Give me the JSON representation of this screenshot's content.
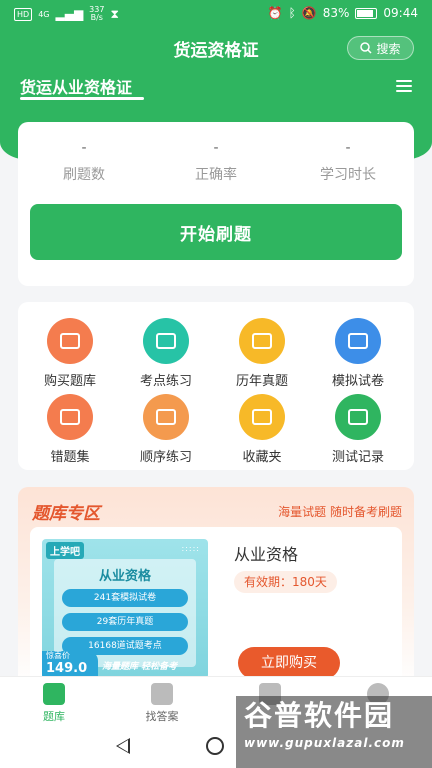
{
  "status_bar": {
    "network": "HD",
    "signal": "4G",
    "speed_value": "337",
    "speed_unit": "B/s",
    "battery": "83%",
    "time": "09:44"
  },
  "header": {
    "title": "货运资格证",
    "search_label": "搜索",
    "cert_tab": "货运从业资格证"
  },
  "stats": [
    {
      "value": "-",
      "label": "刷题数"
    },
    {
      "value": "-",
      "label": "正确率"
    },
    {
      "value": "-",
      "label": "学习时长"
    }
  ],
  "start_button": "开始刷题",
  "features": [
    {
      "label": "购买题库",
      "color": "#f47c4e",
      "icon": "cart-icon"
    },
    {
      "label": "考点练习",
      "color": "#27c3a6",
      "icon": "star-board-icon"
    },
    {
      "label": "历年真题",
      "color": "#f7b928",
      "icon": "calendar-icon"
    },
    {
      "label": "模拟试卷",
      "color": "#3d8ee8",
      "icon": "presentation-icon"
    },
    {
      "label": "错题集",
      "color": "#f47c4e",
      "icon": "wrong-box-icon"
    },
    {
      "label": "顺序练习",
      "color": "#f49a4e",
      "icon": "edit-doc-icon"
    },
    {
      "label": "收藏夹",
      "color": "#f7b928",
      "icon": "star-icon"
    },
    {
      "label": "测试记录",
      "color": "#2fb560",
      "icon": "record-icon"
    }
  ],
  "bank": {
    "title": "题库专区",
    "slogan": "海量试题 随时备考刷题",
    "cover_brand": "上学吧",
    "cover_title": "从业资格",
    "cover_items": [
      "241套模拟试卷",
      "29套历年真题",
      "16168道试题考点"
    ],
    "cover_price_label": "惊喜价",
    "cover_price": "149.0",
    "cover_tagline": "海量题库 轻松备考",
    "product_name": "从业资格",
    "validity": "有效期：180天",
    "buy_label": "立即购买"
  },
  "bottom_nav": [
    {
      "label": "题库",
      "active": true
    },
    {
      "label": "找答案",
      "active": false
    },
    {
      "label": "",
      "active": false
    },
    {
      "label": "",
      "active": false
    }
  ],
  "watermark": {
    "main": "谷普软件园",
    "url": "www.gupuxlazal.com"
  },
  "colors": {
    "brand_green": "#2fb560",
    "accent_orange": "#e95a2c"
  }
}
